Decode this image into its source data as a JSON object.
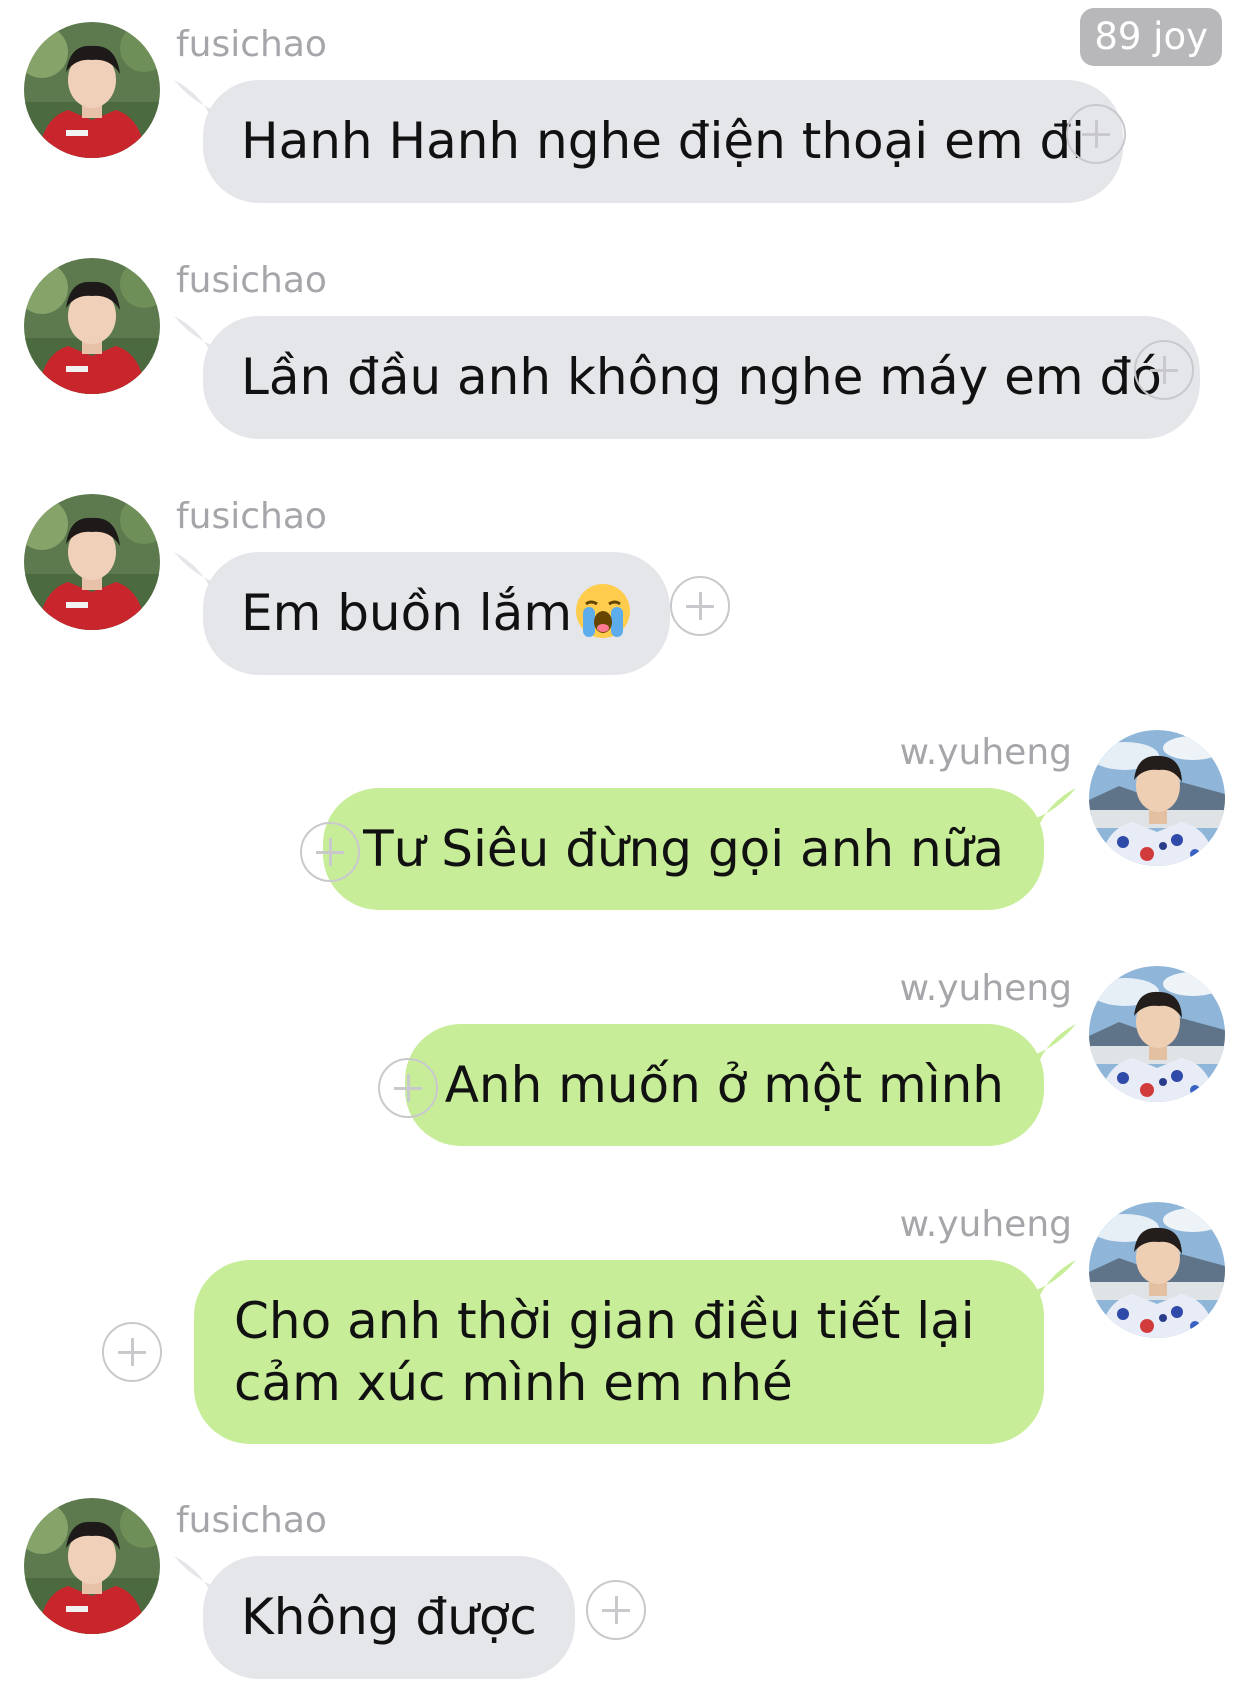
{
  "status": {
    "badge": "89 joy"
  },
  "contacts": {
    "left": {
      "name": "fusichao",
      "avatar_icon": "avatar-red-hoodie"
    },
    "right": {
      "name": "w.yuheng",
      "avatar_icon": "avatar-blue-shirt-mountains"
    }
  },
  "colors": {
    "incoming_bubble": "#e5e6ea",
    "outgoing_bubble": "#c7ed98",
    "sender_name": "#a6a6aa",
    "add_icon": "#c9c9cd"
  },
  "messages": [
    {
      "side": "left",
      "sender": "fusichao",
      "text": "Hanh Hanh nghe điện thoại em đi"
    },
    {
      "side": "left",
      "sender": "fusichao",
      "text": "Lần đầu anh không nghe máy em đó"
    },
    {
      "side": "left",
      "sender": "fusichao",
      "text": "Em buồn lắm",
      "emoji": "loudly-crying-face-icon"
    },
    {
      "side": "right",
      "sender": "w.yuheng",
      "text": "Tư Siêu đừng gọi anh nữa"
    },
    {
      "side": "right",
      "sender": "w.yuheng",
      "text": "Anh muốn ở một mình"
    },
    {
      "side": "right",
      "sender": "w.yuheng",
      "text": "Cho anh thời gian điều tiết lại cảm xúc mình em nhé"
    },
    {
      "side": "left",
      "sender": "fusichao",
      "text": "Không được"
    }
  ]
}
